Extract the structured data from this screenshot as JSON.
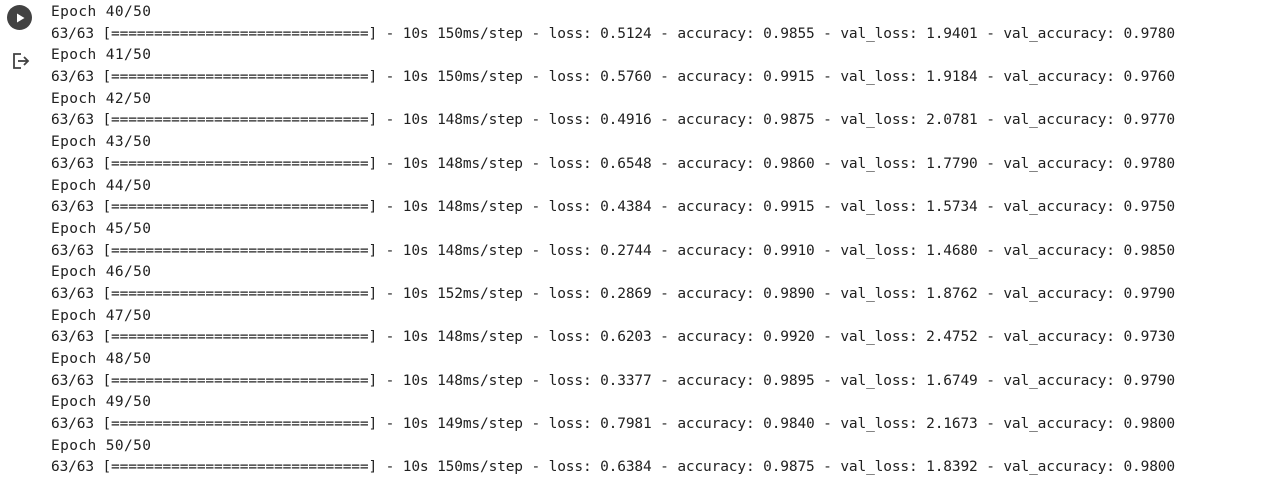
{
  "run_button": {
    "icon": "play-icon"
  },
  "output_button": {
    "icon": "output-redirect-icon"
  },
  "output": {
    "lines": [
      {
        "epoch": "Epoch 40/50",
        "progress": "63/63 [==============================] - 10s 150ms/step - loss: 0.5124 - accuracy: 0.9855 - val_loss: 1.9401 - val_accuracy: 0.9780"
      },
      {
        "epoch": "Epoch 41/50",
        "progress": "63/63 [==============================] - 10s 150ms/step - loss: 0.5760 - accuracy: 0.9915 - val_loss: 1.9184 - val_accuracy: 0.9760"
      },
      {
        "epoch": "Epoch 42/50",
        "progress": "63/63 [==============================] - 10s 148ms/step - loss: 0.4916 - accuracy: 0.9875 - val_loss: 2.0781 - val_accuracy: 0.9770"
      },
      {
        "epoch": "Epoch 43/50",
        "progress": "63/63 [==============================] - 10s 148ms/step - loss: 0.6548 - accuracy: 0.9860 - val_loss: 1.7790 - val_accuracy: 0.9780"
      },
      {
        "epoch": "Epoch 44/50",
        "progress": "63/63 [==============================] - 10s 148ms/step - loss: 0.4384 - accuracy: 0.9915 - val_loss: 1.5734 - val_accuracy: 0.9750"
      },
      {
        "epoch": "Epoch 45/50",
        "progress": "63/63 [==============================] - 10s 148ms/step - loss: 0.2744 - accuracy: 0.9910 - val_loss: 1.4680 - val_accuracy: 0.9850"
      },
      {
        "epoch": "Epoch 46/50",
        "progress": "63/63 [==============================] - 10s 152ms/step - loss: 0.2869 - accuracy: 0.9890 - val_loss: 1.8762 - val_accuracy: 0.9790"
      },
      {
        "epoch": "Epoch 47/50",
        "progress": "63/63 [==============================] - 10s 148ms/step - loss: 0.6203 - accuracy: 0.9920 - val_loss: 2.4752 - val_accuracy: 0.9730"
      },
      {
        "epoch": "Epoch 48/50",
        "progress": "63/63 [==============================] - 10s 148ms/step - loss: 0.3377 - accuracy: 0.9895 - val_loss: 1.6749 - val_accuracy: 0.9790"
      },
      {
        "epoch": "Epoch 49/50",
        "progress": "63/63 [==============================] - 10s 149ms/step - loss: 0.7981 - accuracy: 0.9840 - val_loss: 2.1673 - val_accuracy: 0.9800"
      },
      {
        "epoch": "Epoch 50/50",
        "progress": "63/63 [==============================] - 10s 150ms/step - loss: 0.6384 - accuracy: 0.9875 - val_loss: 1.8392 - val_accuracy: 0.9800"
      }
    ]
  }
}
